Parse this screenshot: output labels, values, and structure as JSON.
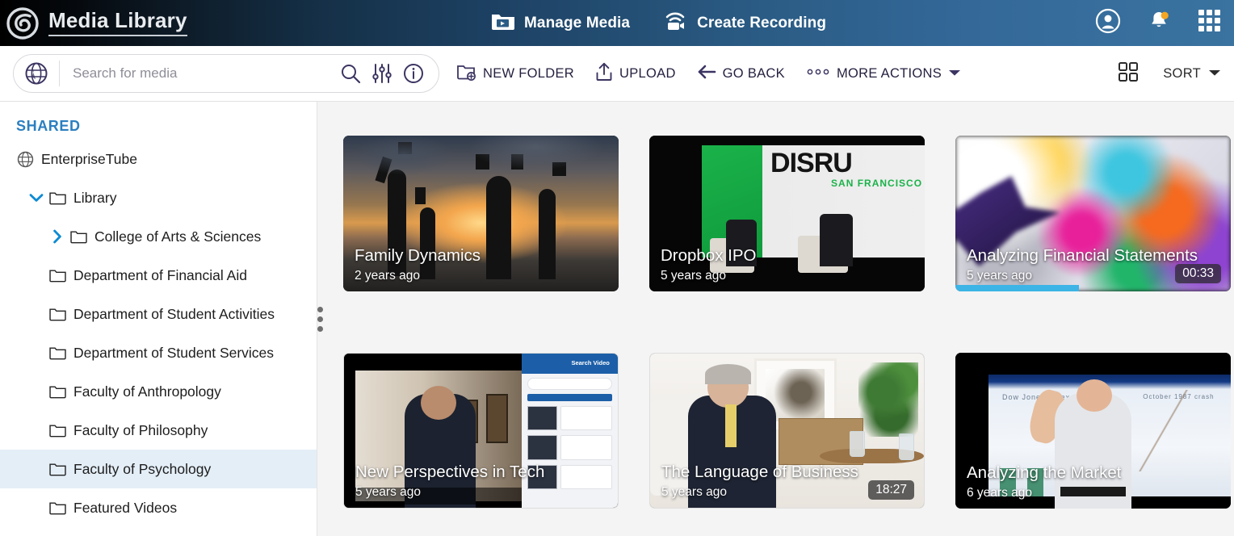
{
  "header": {
    "logo_icon": "spiral-logo-icon",
    "title": "Media Library",
    "nav": [
      {
        "label": "Manage Media",
        "icon": "manage-media-icon"
      },
      {
        "label": "Create Recording",
        "icon": "create-recording-icon"
      }
    ],
    "right_icons": [
      {
        "name": "user-account-icon"
      },
      {
        "name": "notifications-bell-icon",
        "badge": true
      },
      {
        "name": "apps-grid-icon"
      }
    ],
    "colors": {
      "gradient_start": "#000000",
      "gradient_end": "#3a739f",
      "badge": "#f5a623"
    }
  },
  "toolbar": {
    "search": {
      "globe_icon": "globe-icon",
      "placeholder": "Search for media",
      "value": "",
      "icons": [
        "search-icon",
        "filter-sliders-icon",
        "info-icon"
      ]
    },
    "actions": [
      {
        "label": "NEW FOLDER",
        "icon": "new-folder-icon"
      },
      {
        "label": "UPLOAD",
        "icon": "upload-icon"
      },
      {
        "label": "GO BACK",
        "icon": "arrow-left-icon"
      },
      {
        "label": "MORE ACTIONS",
        "icon": "three-dots-icon",
        "has_caret": true
      }
    ],
    "view_toggle_icon": "grid-view-icon",
    "sort_label": "SORT",
    "sort_caret_icon": "chevron-down-icon"
  },
  "sidebar": {
    "section_title": "SHARED",
    "tree": [
      {
        "label": "EnterpriseTube",
        "level": 0,
        "icon": "globe-icon",
        "caret": "none",
        "selected": false
      },
      {
        "label": "Library",
        "level": 1,
        "icon": "folder-icon",
        "caret": "down",
        "selected": false
      },
      {
        "label": "College of Arts & Sciences",
        "level": 2,
        "icon": "folder-icon",
        "caret": "right",
        "selected": false
      },
      {
        "label": "Department of Financial Aid",
        "level": 2,
        "icon": "folder-icon",
        "caret": "none",
        "selected": false
      },
      {
        "label": "Department of Student Activities",
        "level": 2,
        "icon": "folder-icon",
        "caret": "none",
        "selected": false
      },
      {
        "label": "Department of Student Services",
        "level": 2,
        "icon": "folder-icon",
        "caret": "none",
        "selected": false
      },
      {
        "label": "Faculty of Anthropology",
        "level": 2,
        "icon": "folder-icon",
        "caret": "none",
        "selected": false
      },
      {
        "label": "Faculty of Philosophy",
        "level": 2,
        "icon": "folder-icon",
        "caret": "none",
        "selected": false
      },
      {
        "label": "Faculty of Psychology",
        "level": 2,
        "icon": "folder-icon",
        "caret": "none",
        "selected": true
      },
      {
        "label": "Featured Videos",
        "level": 1,
        "icon": "folder-icon",
        "caret": "none",
        "selected": false
      }
    ],
    "resize_handle_icon": "drag-handle-icon",
    "selected_bg": "#e4eef7",
    "section_color": "#2b7fc0"
  },
  "media": {
    "cards": [
      {
        "title": "Family Dynamics",
        "date": "2 years ago",
        "duration": "",
        "progress_pct": 0,
        "thumb": "family-sunset-thumbnail"
      },
      {
        "title": "Dropbox IPO",
        "date": "5 years ago",
        "duration": "",
        "progress_pct": 0,
        "thumb": "disrupt-stage-thumbnail"
      },
      {
        "title": "Analyzing Financial Statements",
        "date": "5 years ago",
        "duration": "00:33",
        "progress_pct": 45,
        "thumb": "paper-cranes-thumbnail"
      },
      {
        "title": "New Perspectives in Tech",
        "date": "5 years ago",
        "duration": "",
        "progress_pct": 0,
        "thumb": "video-player-thumbnail"
      },
      {
        "title": "The Language of Business",
        "date": "5 years ago",
        "duration": "18:27",
        "progress_pct": 0,
        "thumb": "interview-room-thumbnail"
      },
      {
        "title": "Analyzing the Market",
        "date": "6 years ago",
        "duration": "",
        "progress_pct": 0,
        "thumb": "speaker-stage-thumbnail"
      }
    ],
    "progress_color": "#3cb4e5"
  }
}
